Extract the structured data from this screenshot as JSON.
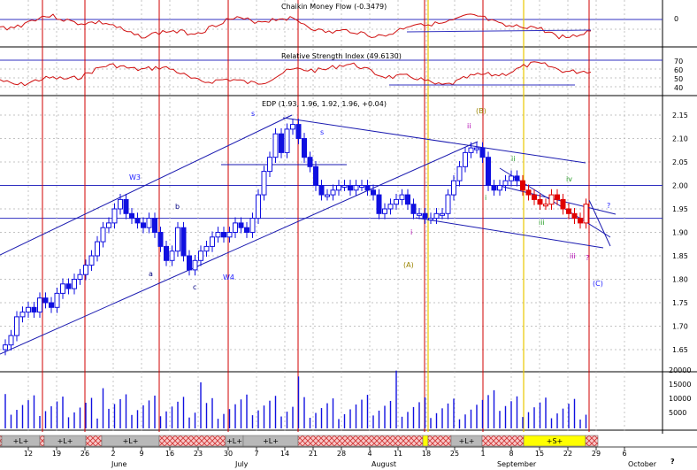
{
  "chart_data": {
    "type": "candlestick",
    "panels": {
      "cmf": {
        "title": "Chaikin Money Flow (-0.3479)",
        "ticks": [
          "0"
        ]
      },
      "rsi": {
        "title": "Relative Strength Index (49.6130)",
        "ticks": [
          "70",
          "60",
          "50",
          "40"
        ]
      },
      "price": {
        "title": "EDP (1.93, 1.96, 1.92, 1.96, +0.04)",
        "ylim": [
          1.6,
          2.2
        ],
        "ticks": [
          "2.15",
          "2.10",
          "2.05",
          "2.00",
          "1.95",
          "1.90",
          "1.85",
          "1.80",
          "1.75",
          "1.70",
          "1.65"
        ],
        "close": [
          1.66,
          1.68,
          1.72,
          1.73,
          1.74,
          1.73,
          1.76,
          1.75,
          1.74,
          1.77,
          1.79,
          1.78,
          1.8,
          1.81,
          1.83,
          1.85,
          1.88,
          1.91,
          1.92,
          1.95,
          1.97,
          1.94,
          1.93,
          1.92,
          1.91,
          1.93,
          1.9,
          1.87,
          1.84,
          1.86,
          1.91,
          1.85,
          1.82,
          1.84,
          1.86,
          1.87,
          1.89,
          1.9,
          1.89,
          1.9,
          1.92,
          1.91,
          1.9,
          1.93,
          1.98,
          2.03,
          2.06,
          2.11,
          2.07,
          2.12,
          2.13,
          2.1,
          2.06,
          2.04,
          2.0,
          1.98,
          1.98,
          1.99,
          2.0,
          2.0,
          1.99,
          2.0,
          2.0,
          1.99,
          1.98,
          1.94,
          1.95,
          1.96,
          1.97,
          1.98,
          1.96,
          1.94,
          1.94,
          1.93,
          1.93,
          1.94,
          1.94,
          1.98,
          2.01,
          2.04,
          2.07,
          2.08,
          2.08,
          2.06,
          2.0,
          1.99,
          2.0,
          2.01,
          2.02,
          2.01,
          1.99,
          1.98,
          1.97,
          1.96,
          1.96,
          1.98,
          1.97,
          1.95,
          1.94,
          1.93,
          1.92,
          1.96
        ]
      },
      "volume": {
        "ticks": [
          "20000",
          "15000",
          "10000",
          "5000"
        ]
      }
    },
    "wave_labels": [
      {
        "text": "W3",
        "color": "#1a1aff"
      },
      {
        "text": "a",
        "color": "#000080"
      },
      {
        "text": "b",
        "color": "#000080"
      },
      {
        "text": "c",
        "color": "#000080"
      },
      {
        "text": "W4",
        "color": "#1a1aff"
      },
      {
        "text": "s",
        "color": "#1a1aff"
      },
      {
        "text": "s",
        "color": "#1a1aff"
      },
      {
        "text": "(B)",
        "color": "#9a8400"
      },
      {
        "text": "ii",
        "color": "#b000b0"
      },
      {
        "text": "i",
        "color": "#b000b0"
      },
      {
        "text": "(A)",
        "color": "#9a8400"
      },
      {
        "text": "i",
        "color": "#2aa02a"
      },
      {
        "text": "ii",
        "color": "#2aa02a"
      },
      {
        "text": "iii",
        "color": "#2aa02a"
      },
      {
        "text": "iv",
        "color": "#2aa02a"
      },
      {
        "text": "iii",
        "color": "#b000b0"
      },
      {
        "text": "?",
        "color": "#1a1aff"
      },
      {
        "text": "?",
        "color": "#b000b0"
      },
      {
        "text": "(C)",
        "color": "#1a1aff"
      }
    ],
    "bands": [
      "+L+",
      "+L+",
      "+L+",
      "+L+",
      "+L+",
      "+S+"
    ],
    "date_axis": {
      "days": [
        "12",
        "19",
        "26",
        "2",
        "9",
        "16",
        "23",
        "30",
        "7",
        "14",
        "21",
        "28",
        "4",
        "11",
        "18",
        "25",
        "1",
        "8",
        "15",
        "22",
        "29",
        "6"
      ],
      "months": [
        "June",
        "July",
        "August",
        "September",
        "October"
      ],
      "corner": "?"
    }
  }
}
